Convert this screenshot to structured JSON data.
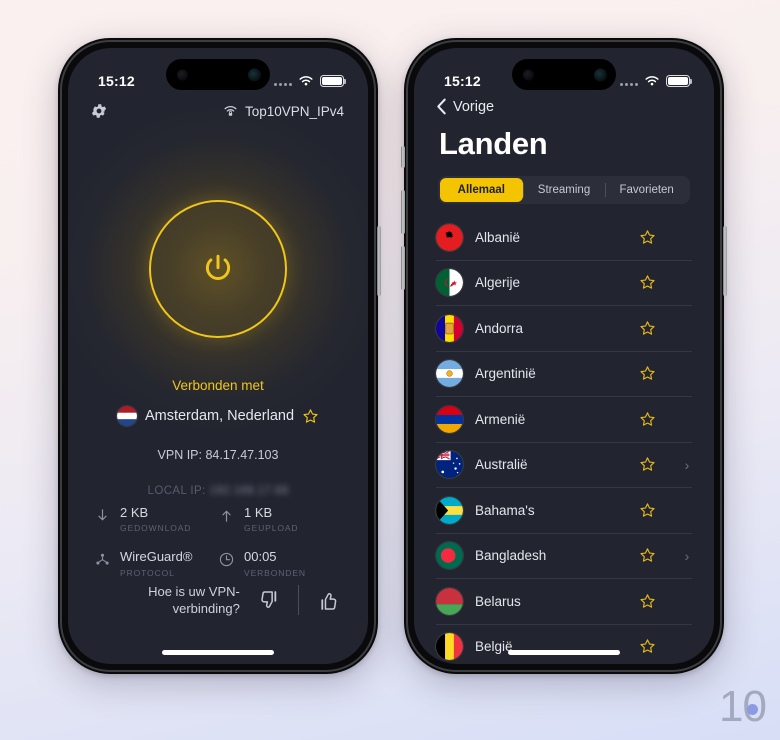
{
  "background": {
    "top_color": "#faf0ef",
    "bottom_color": "#d7def6"
  },
  "watermark": {
    "text": "10"
  },
  "accent": {
    "yellow": "#f0c61a",
    "segment_yellow": "#f5c400",
    "screen_bg": "#22252f"
  },
  "phone1": {
    "status_bar": {
      "time": "15:12"
    },
    "nav": {
      "gear_icon": "gear-icon",
      "wifi_icon": "wifi-lock-icon",
      "network_name": "Top10VPN_IPv4"
    },
    "power_button": {
      "icon": "power-icon",
      "state": "connected"
    },
    "connected_label": "Verbonden met",
    "location": {
      "name": "Amsterdam, Nederland",
      "flag": "netherlands-flag",
      "star_icon": "star-icon"
    },
    "vpn_ip": "VPN IP: 84.17.47.103",
    "local_ip_label": "LOCAL IP:",
    "local_ip_value": "192.168.17.68",
    "stats": [
      {
        "icon": "download-arrow-icon",
        "value": "2 KB",
        "caption": "GEDOWNLOAD"
      },
      {
        "icon": "upload-arrow-icon",
        "value": "1 KB",
        "caption": "GEUPLOAD"
      },
      {
        "icon": "protocol-node-icon",
        "value": "WireGuard®",
        "caption": "PROTOCOL"
      },
      {
        "icon": "clock-icon",
        "value": "00:05",
        "caption": "VERBONDEN"
      }
    ],
    "feedback": {
      "question": "Hoe is uw VPN-verbinding?",
      "thumbs_down_icon": "thumbs-down-icon",
      "thumbs_up_icon": "thumbs-up-icon"
    }
  },
  "phone2": {
    "status_bar": {
      "time": "15:12"
    },
    "back_label": "Vorige",
    "back_icon": "chevron-left-icon",
    "title": "Landen",
    "segments": [
      {
        "label": "Allemaal",
        "active": true
      },
      {
        "label": "Streaming",
        "active": false
      },
      {
        "label": "Favorieten",
        "active": false
      }
    ],
    "countries": [
      {
        "name": "Albanië",
        "flag": "albania",
        "star": true,
        "chevron": false
      },
      {
        "name": "Algerije",
        "flag": "algeria",
        "star": true,
        "chevron": false
      },
      {
        "name": "Andorra",
        "flag": "andorra",
        "star": true,
        "chevron": false
      },
      {
        "name": "Argentinië",
        "flag": "argentina",
        "star": true,
        "chevron": false
      },
      {
        "name": "Armenië",
        "flag": "armenia",
        "star": true,
        "chevron": false
      },
      {
        "name": "Australië",
        "flag": "australia",
        "star": true,
        "chevron": true
      },
      {
        "name": "Bahama's",
        "flag": "bahamas",
        "star": true,
        "chevron": false
      },
      {
        "name": "Bangladesh",
        "flag": "bangladesh",
        "star": true,
        "chevron": true
      },
      {
        "name": "Belarus",
        "flag": "belarus",
        "star": true,
        "chevron": false
      },
      {
        "name": "België",
        "flag": "belgium",
        "star": true,
        "chevron": false
      }
    ]
  }
}
